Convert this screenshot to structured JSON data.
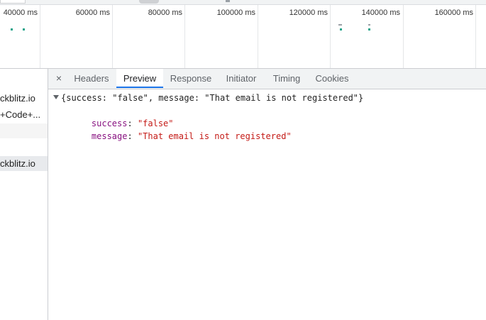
{
  "timeline": {
    "ticks": [
      "40000 ms",
      "60000 ms",
      "80000 ms",
      "100000 ms",
      "120000 ms",
      "140000 ms",
      "160000 ms"
    ]
  },
  "request_list": {
    "rows": [
      "ckblitz.io",
      "+Code+...",
      "",
      "",
      "ckblitz.io"
    ]
  },
  "detail": {
    "close_label": "×",
    "tabs": [
      "Headers",
      "Preview",
      "Response",
      "Initiator",
      "Timing",
      "Cookies"
    ],
    "active_tab": "Preview"
  },
  "preview": {
    "summary": "{success: \"false\", message: \"That email is not registered\"}",
    "fields": [
      {
        "key": "success",
        "sep": ": ",
        "value": "\"false\""
      },
      {
        "key": "message",
        "sep": ": ",
        "value": "\"That email is not registered\""
      }
    ]
  },
  "colors": {
    "tab_underline": "#1a73e8",
    "json_key": "#881280",
    "json_string": "#c41a16",
    "timeline_mark": "#1fa48a"
  }
}
